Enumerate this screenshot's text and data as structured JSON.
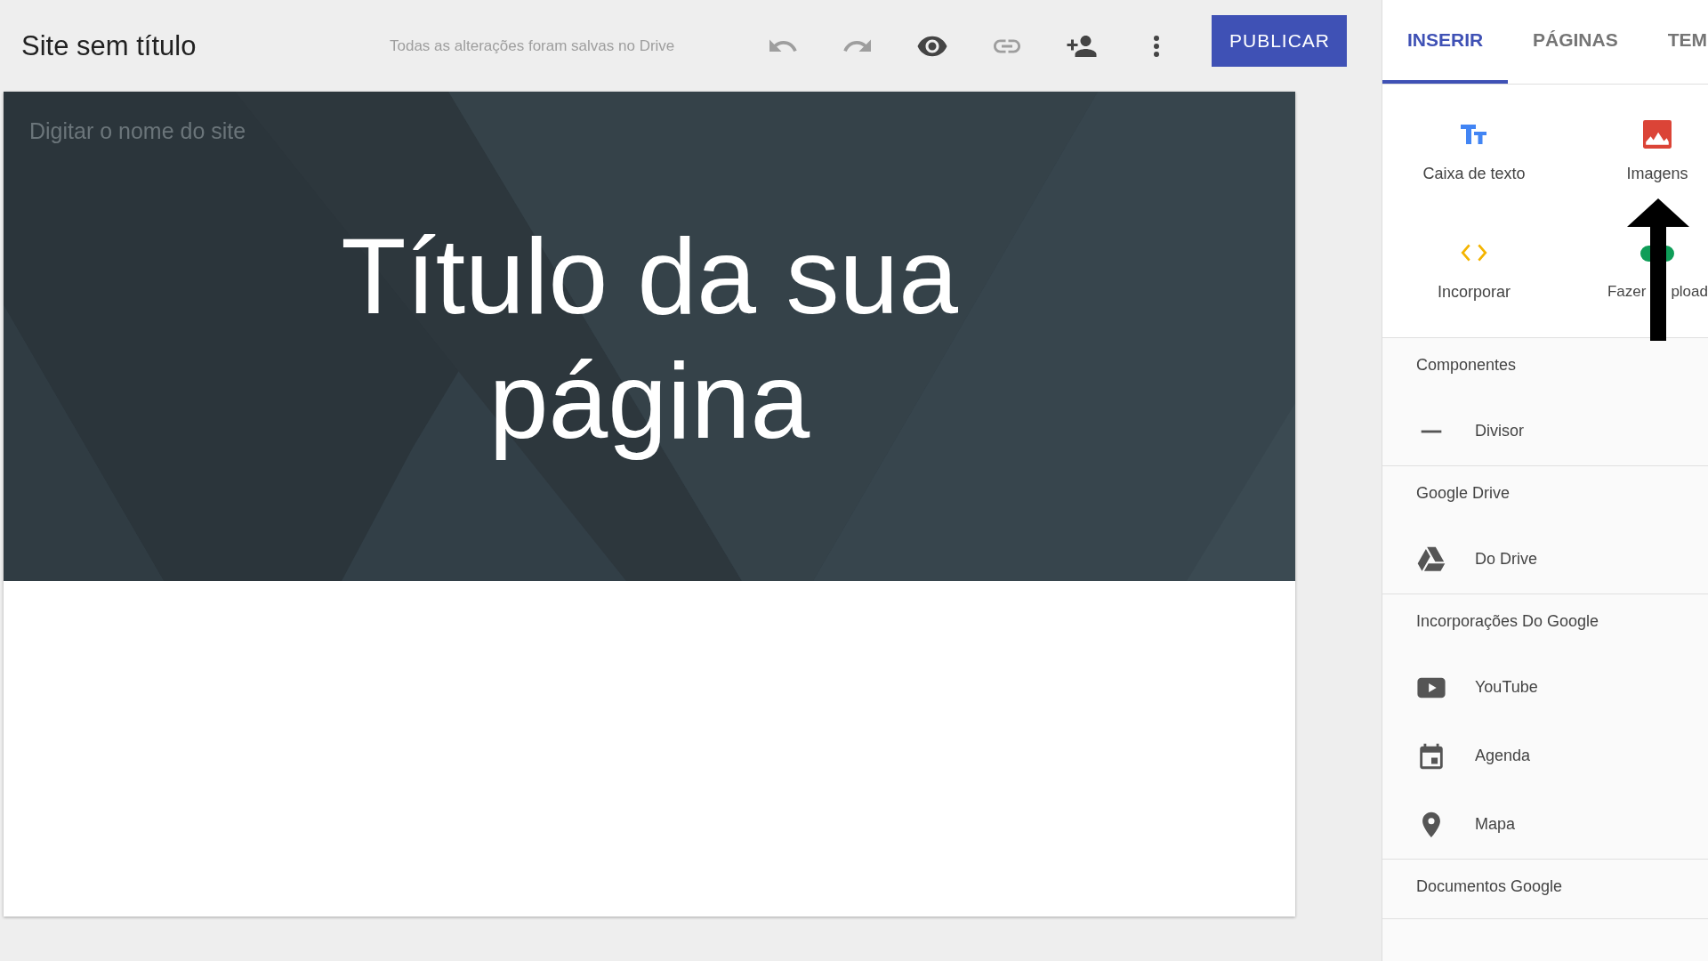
{
  "toolbar": {
    "site_title": "Site sem título",
    "save_status": "Todas as alterações foram salvas no Drive",
    "actions": [
      {
        "kind": "undo"
      },
      {
        "kind": "redo"
      },
      {
        "kind": "preview"
      },
      {
        "kind": "link"
      },
      {
        "kind": "share"
      },
      {
        "kind": "more"
      }
    ],
    "publish_button": "PUBLICAR"
  },
  "editor": {
    "site_name_placeholder": "Digitar o nome do site",
    "page_title": "Título da sua página"
  },
  "sidebar": {
    "tabs": [
      {
        "label": "INSERIR",
        "selected": true
      },
      {
        "label": "PÁGINAS",
        "selected": false
      },
      {
        "label": "TEM",
        "selected": false
      }
    ],
    "tiles": [
      {
        "kind": "text",
        "label_parts": [
          "Caixa de texto"
        ]
      },
      {
        "kind": "images",
        "label_parts": [
          "Imagens"
        ]
      },
      {
        "kind": "embed",
        "label_parts": [
          "Incorporar"
        ]
      },
      {
        "kind": "upload",
        "label_parts": [
          "Fazer",
          "pload"
        ]
      }
    ],
    "sections": [
      {
        "title": "Componentes",
        "items": [
          {
            "kind": "divider",
            "label": "Divisor"
          }
        ]
      },
      {
        "title": "Google Drive",
        "items": [
          {
            "kind": "drive",
            "label": "Do Drive"
          }
        ]
      },
      {
        "title": "Incorporações Do Google",
        "items": [
          {
            "kind": "youtube",
            "label": "YouTube"
          },
          {
            "kind": "calendar",
            "label": "Agenda"
          },
          {
            "kind": "map",
            "label": "Mapa"
          }
        ]
      },
      {
        "title": "Documentos Google"
      }
    ]
  }
}
